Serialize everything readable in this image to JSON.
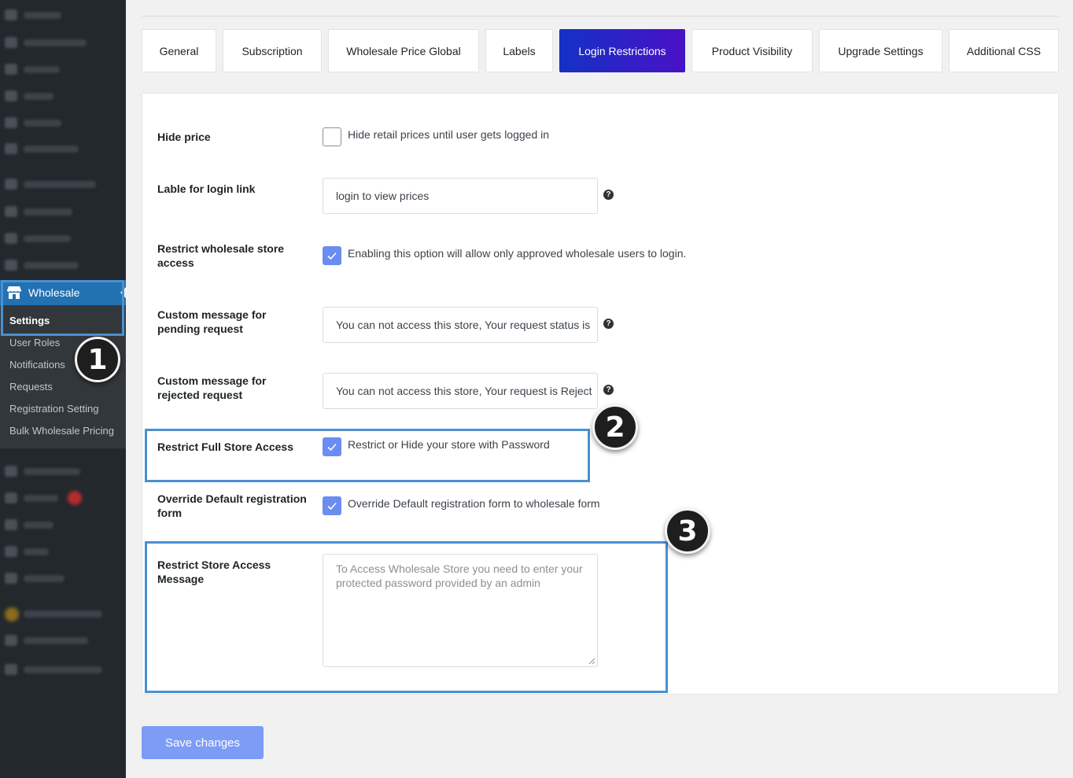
{
  "sidebar": {
    "wholesale_label": "Wholesale",
    "icon": "store-icon",
    "submenu": [
      {
        "label": "Settings",
        "active": true
      },
      {
        "label": "User Roles",
        "active": false
      },
      {
        "label": "Notifications",
        "active": false
      },
      {
        "label": "Requests",
        "active": false
      },
      {
        "label": "Registration Setting",
        "active": false
      },
      {
        "label": "Bulk Wholesale Pricing",
        "active": false
      }
    ]
  },
  "tabs": [
    {
      "label": "General",
      "active": false
    },
    {
      "label": "Subscription",
      "active": false
    },
    {
      "label": "Wholesale Price Global",
      "active": false
    },
    {
      "label": "Labels",
      "active": false
    },
    {
      "label": "Login Restrictions",
      "active": true
    },
    {
      "label": "Product Visibility",
      "active": false
    },
    {
      "label": "Upgrade Settings",
      "active": false
    },
    {
      "label": "Additional CSS",
      "active": false
    }
  ],
  "settings": {
    "hide_price": {
      "label": "Hide price",
      "checked": false,
      "text": "Hide retail prices until user gets logged in"
    },
    "login_link": {
      "label": "Lable for login link",
      "value": "login to view prices"
    },
    "restrict_wholesale": {
      "label": "Restrict wholesale store access",
      "checked": true,
      "text": "Enabling this option will allow only approved wholesale users to login."
    },
    "pending_message": {
      "label": "Custom message for pending request",
      "value": "You can not access this store, Your request status is"
    },
    "rejected_message": {
      "label": "Custom message for rejected request",
      "value": "You can not access this store, Your request is Reject"
    },
    "restrict_full": {
      "label": "Restrict Full Store Access",
      "checked": true,
      "text": "Restrict or Hide your store with Password"
    },
    "override_registration": {
      "label": "Override Default registration form",
      "checked": true,
      "text": "Override Default registration form to wholesale form"
    },
    "restrict_message": {
      "label": "Restrict Store Access Message",
      "placeholder": "To Access Wholesale Store you need to enter your protected password provided by an admin"
    }
  },
  "help_glyph": "?",
  "save_label": "Save changes",
  "annotations": [
    "1",
    "2",
    "3"
  ],
  "colors": {
    "accent": "#2271b1",
    "tab_active_start": "#1431c4",
    "tab_active_end": "#4a11c7",
    "checkbox": "#6b8cf0",
    "highlight": "#4a90d0"
  }
}
